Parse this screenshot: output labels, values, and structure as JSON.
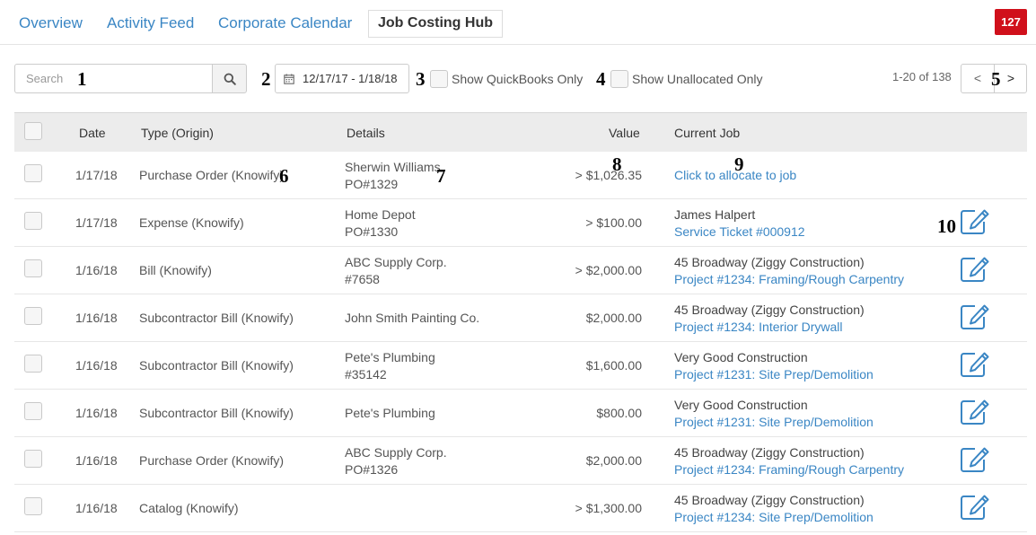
{
  "nav": {
    "tabs": [
      {
        "label": "Overview"
      },
      {
        "label": "Activity Feed"
      },
      {
        "label": "Corporate Calendar"
      },
      {
        "label": "Job Costing Hub"
      }
    ],
    "badge": "127"
  },
  "toolbar": {
    "search_placeholder": "Search",
    "date_range": "12/17/17 - 1/18/18",
    "quickbooks_label": "Show QuickBooks Only",
    "unallocated_label": "Show Unallocated Only",
    "pagination": "1-20 of 138",
    "prev": "<",
    "next": ">"
  },
  "markers": [
    "1",
    "2",
    "3",
    "4",
    "5",
    "6",
    "7",
    "8",
    "9",
    "10"
  ],
  "table": {
    "columns": [
      "Date",
      "Type (Origin)",
      "Details",
      "Value",
      "Current Job"
    ],
    "rows": [
      {
        "date": "1/17/18",
        "type": "Purchase Order (Knowify)",
        "d1": "Sherwin Williams",
        "d2": "PO#1329",
        "value": "> $1,026.35",
        "job": "",
        "link": "Click to allocate to job"
      },
      {
        "date": "1/17/18",
        "type": "Expense (Knowify)",
        "d1": "Home Depot",
        "d2": "PO#1330",
        "value": "> $100.00",
        "job": "James Halpert",
        "link": "Service Ticket #000912"
      },
      {
        "date": "1/16/18",
        "type": "Bill (Knowify)",
        "d1": "ABC Supply Corp.",
        "d2": "#7658",
        "value": "> $2,000.00",
        "job": "45 Broadway (Ziggy Construction)",
        "link": "Project #1234: Framing/Rough Carpentry"
      },
      {
        "date": "1/16/18",
        "type": "Subcontractor Bill (Knowify)",
        "d1": "John Smith Painting Co.",
        "d2": "",
        "value": "$2,000.00",
        "job": "45 Broadway (Ziggy Construction)",
        "link": "Project #1234: Interior Drywall"
      },
      {
        "date": "1/16/18",
        "type": "Subcontractor Bill (Knowify)",
        "d1": "Pete's Plumbing",
        "d2": "#35142",
        "value": "$1,600.00",
        "job": "Very Good Construction",
        "link": "Project #1231: Site Prep/Demolition"
      },
      {
        "date": "1/16/18",
        "type": "Subcontractor Bill (Knowify)",
        "d1": "Pete's Plumbing",
        "d2": "",
        "value": "$800.00",
        "job": "Very Good Construction",
        "link": "Project #1231: Site Prep/Demolition"
      },
      {
        "date": "1/16/18",
        "type": "Purchase Order (Knowify)",
        "d1": "ABC Supply Corp.",
        "d2": "PO#1326",
        "value": "$2,000.00",
        "job": "45 Broadway (Ziggy Construction)",
        "link": "Project #1234: Framing/Rough Carpentry"
      },
      {
        "date": "1/16/18",
        "type": "Catalog (Knowify)",
        "d1": "",
        "d2": "",
        "value": "> $1,300.00",
        "job": "45 Broadway (Ziggy Construction)",
        "link": "Project #1234: Site Prep/Demolition"
      }
    ]
  },
  "colors": {
    "accent": "#3a86c4",
    "badge": "#d0101b",
    "header_bg": "#ececec"
  },
  "icons": [
    "search-icon",
    "calendar-icon",
    "edit-icon"
  ]
}
